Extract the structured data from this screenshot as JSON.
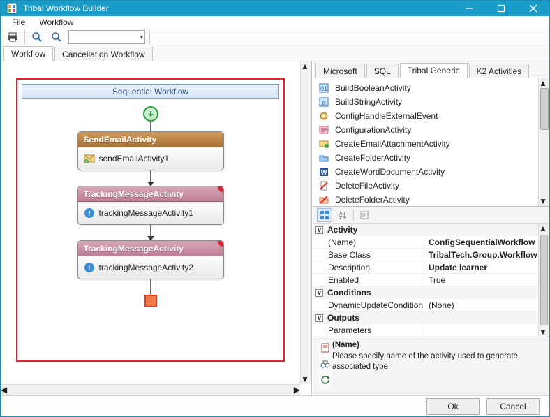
{
  "window": {
    "title": "Tribal Workflow Builder"
  },
  "menus": {
    "file": "File",
    "workflow": "Workflow"
  },
  "tabs": {
    "workflow": "Workflow",
    "cancellation": "Cancellation Workflow"
  },
  "seq": {
    "title": "Sequential Workflow",
    "activities": [
      {
        "type": "SendEmailActivity",
        "instance": "sendEmailActivity1"
      },
      {
        "type": "TrackingMessageActivity",
        "instance": "trackingMessageActivity1"
      },
      {
        "type": "TrackingMessageActivity",
        "instance": "trackingMessageActivity2"
      }
    ]
  },
  "toolbox": {
    "tabs": {
      "microsoft": "Microsoft",
      "sql": "SQL",
      "tribal": "Tribal Generic",
      "k2": "K2 Activities"
    },
    "items": [
      "BuildBooleanActivity",
      "BuildStringActivity",
      "ConfigHandleExternalEvent",
      "ConfigurationActivity",
      "CreateEmailAttachmentActivity",
      "CreateFolderActivity",
      "CreateWordDocumentActivity",
      "DeleteFileActivity",
      "DeleteFolderActivity"
    ]
  },
  "props": {
    "cat_activity": "Activity",
    "cat_conditions": "Conditions",
    "cat_outputs": "Outputs",
    "rows": {
      "name_k": "(Name)",
      "name_v": "ConfigSequentialWorkflow",
      "base_k": "Base Class",
      "base_v": "TribalTech.Group.Workflow",
      "desc_k": "Description",
      "desc_v": "Update learner",
      "enabled_k": "Enabled",
      "enabled_v": "True",
      "dyn_k": "DynamicUpdateCondition",
      "dyn_v": "(None)",
      "params_k": "Parameters",
      "params_v": ""
    }
  },
  "help": {
    "name": "(Name)",
    "text": "Please specify name of the activity used to generate associated type."
  },
  "buttons": {
    "ok": "Ok",
    "cancel": "Cancel"
  }
}
